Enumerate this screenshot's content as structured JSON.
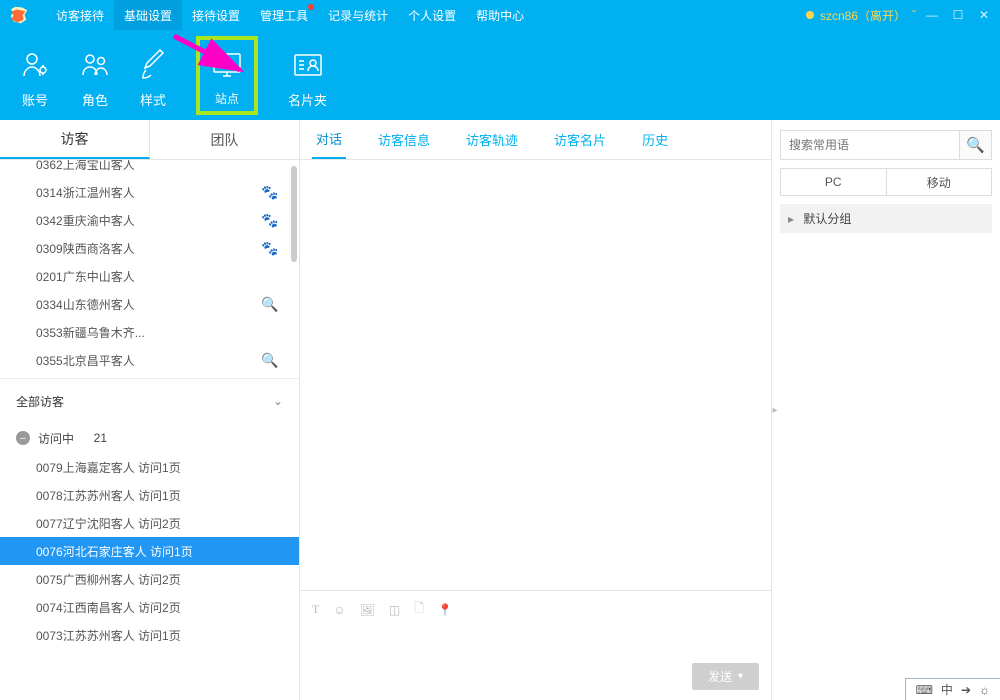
{
  "menu": {
    "items": [
      "访客接待",
      "基础设置",
      "接待设置",
      "管理工具",
      "记录与统计",
      "个人设置",
      "帮助中心"
    ],
    "active": 1,
    "dot_index": 3
  },
  "user": {
    "label": "szcn86（离开）"
  },
  "tools": [
    {
      "name": "account",
      "label": "账号"
    },
    {
      "name": "role",
      "label": "角色"
    },
    {
      "name": "style",
      "label": "样式"
    },
    {
      "name": "site",
      "label": "站点",
      "highlight": true
    },
    {
      "name": "card",
      "label": "名片夹"
    }
  ],
  "left_tabs": {
    "items": [
      "访客",
      "团队"
    ],
    "active": 0
  },
  "visitors": [
    {
      "text": "0362上海宝山客人",
      "icon": ""
    },
    {
      "text": "0314浙江温州客人",
      "icon": "paw"
    },
    {
      "text": "0342重庆渝中客人",
      "icon": "paw"
    },
    {
      "text": "0309陕西商洛客人",
      "icon": "paw"
    },
    {
      "text": "0201广东中山客人",
      "icon": ""
    },
    {
      "text": "0334山东德州客人",
      "icon": "q"
    },
    {
      "text": "0353新疆乌鲁木齐...",
      "icon": ""
    },
    {
      "text": "0355北京昌平客人",
      "icon": "q"
    }
  ],
  "all_visitors_label": "全部访客",
  "visiting": {
    "label": "访问中",
    "count": "21"
  },
  "sessions": [
    {
      "text": "0079上海嘉定客人 访问1页"
    },
    {
      "text": "0078江苏苏州客人 访问1页"
    },
    {
      "text": "0077辽宁沈阳客人 访问2页"
    },
    {
      "text": "0076河北石家庄客人 访问1页",
      "selected": true
    },
    {
      "text": "0075广西柳州客人 访问2页"
    },
    {
      "text": "0074江西南昌客人 访问2页"
    },
    {
      "text": "0073江苏苏州客人 访问1页"
    }
  ],
  "middle_tabs": [
    "对话",
    "访客信息",
    "访客轨迹",
    "访客名片",
    "历史"
  ],
  "send_label": "发送",
  "search_placeholder": "搜索常用语",
  "device_tabs": [
    "PC",
    "移动"
  ],
  "group_label": "默认分组",
  "ime": {
    "a": "中",
    "b": "➔",
    "c": "☼"
  }
}
